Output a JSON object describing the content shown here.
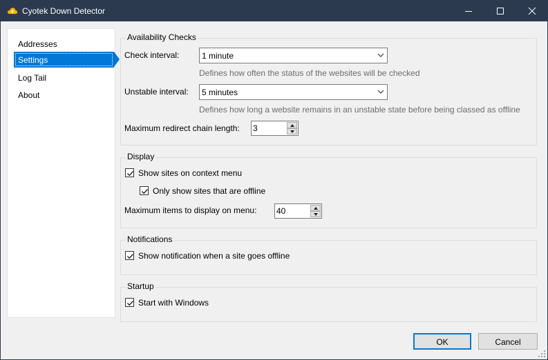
{
  "window": {
    "title": "Cyotek Down Detector",
    "app_icon": "cloud-lightning-icon",
    "controls": [
      "minimize-icon",
      "maximize-icon",
      "close-icon"
    ]
  },
  "sidebar": {
    "items": [
      {
        "label": "Addresses",
        "active": false
      },
      {
        "label": "Settings",
        "active": true
      },
      {
        "label": "Log Tail",
        "active": false
      },
      {
        "label": "About",
        "active": false
      }
    ]
  },
  "availability": {
    "title": "Availability Checks",
    "check_interval": {
      "label": "Check interval:",
      "value": "1 minute",
      "hint": "Defines how often the status of the websites will be checked"
    },
    "unstable_interval": {
      "label": "Unstable interval:",
      "value": "5 minutes",
      "hint": "Defines how long a website remains in an unstable state before being classed as offline"
    },
    "redirect": {
      "label": "Maximum redirect chain length:",
      "value": "3"
    }
  },
  "display": {
    "title": "Display",
    "show_sites": {
      "label": "Show sites on context menu",
      "checked": true
    },
    "only_offline": {
      "label": "Only show sites that are offline",
      "checked": true
    },
    "max_items": {
      "label": "Maximum items to display on menu:",
      "value": "40"
    }
  },
  "notifications": {
    "title": "Notifications",
    "show_notification": {
      "label": "Show notification when a site goes offline",
      "checked": true
    }
  },
  "startup": {
    "title": "Startup",
    "start_with_windows": {
      "label": "Start with Windows",
      "checked": true
    }
  },
  "buttons": {
    "ok": "OK",
    "cancel": "Cancel"
  },
  "colors": {
    "titlebar": "#2b3a4f",
    "accent": "#0078d7",
    "background": "#f0f0f0"
  }
}
